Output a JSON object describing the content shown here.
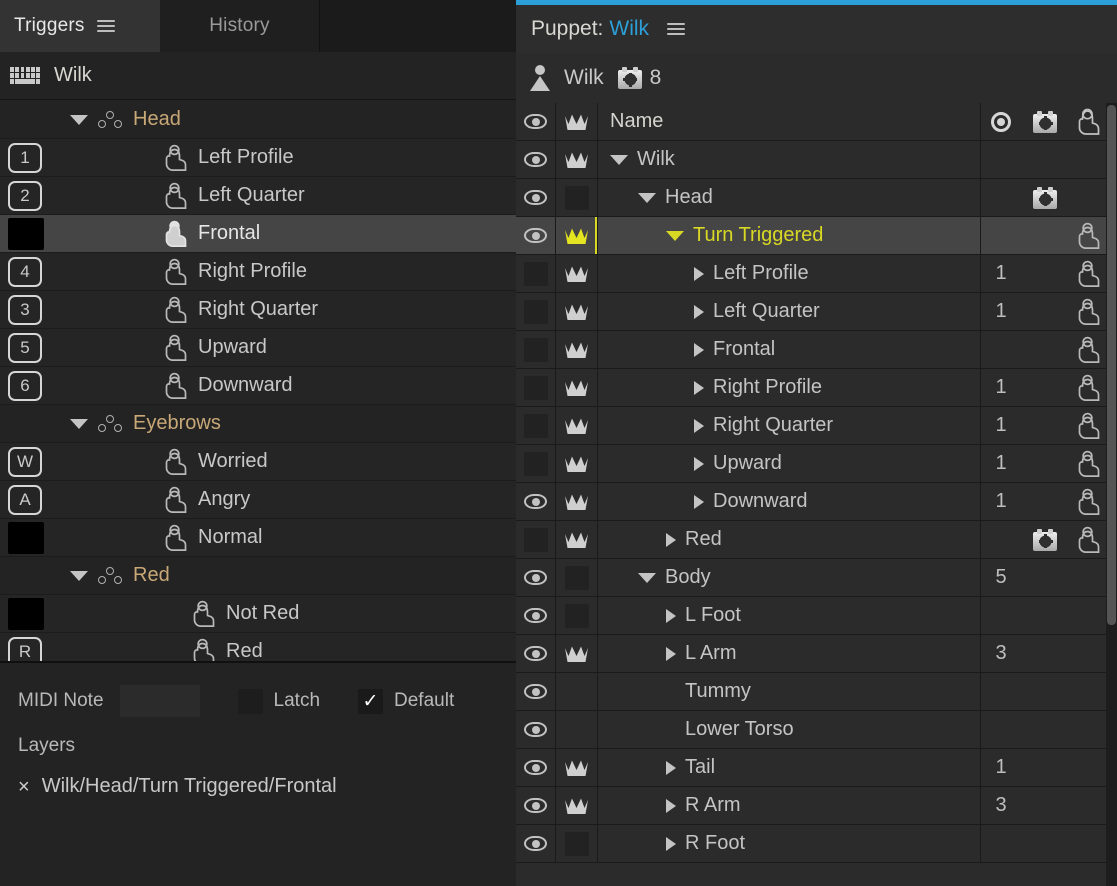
{
  "colors": {
    "accent_blue": "#2d9fd8",
    "selected_yellow": "#d8d825",
    "group_label": "#c9a877",
    "panel_bg": "#2b2b2b",
    "row_selected": "#454545"
  },
  "triggers_panel": {
    "tabs": [
      {
        "label": "Triggers",
        "active": true
      },
      {
        "label": "History",
        "active": false
      }
    ],
    "menu_icon": "hamburger-icon",
    "puppet_bar": {
      "icon": "keyboard-icon",
      "name": "Wilk"
    },
    "rows": [
      {
        "type": "group",
        "label": "Head",
        "indent": 1,
        "expanded": true,
        "icon": "group-icon"
      },
      {
        "type": "trigger",
        "label": "Left Profile",
        "indent": 2,
        "key": "1",
        "selected": false
      },
      {
        "type": "trigger",
        "label": "Left Quarter",
        "indent": 2,
        "key": "2",
        "selected": false
      },
      {
        "type": "trigger",
        "label": "Frontal",
        "indent": 2,
        "key": "",
        "selected": true
      },
      {
        "type": "trigger",
        "label": "Right Profile",
        "indent": 2,
        "key": "4",
        "selected": false
      },
      {
        "type": "trigger",
        "label": "Right Quarter",
        "indent": 2,
        "key": "3",
        "selected": false
      },
      {
        "type": "trigger",
        "label": "Upward",
        "indent": 2,
        "key": "5",
        "selected": false
      },
      {
        "type": "trigger",
        "label": "Downward",
        "indent": 2,
        "key": "6",
        "selected": false
      },
      {
        "type": "group",
        "label": "Eyebrows",
        "indent": 1,
        "expanded": true,
        "icon": "group-icon"
      },
      {
        "type": "trigger",
        "label": "Worried",
        "indent": 2,
        "key": "W",
        "selected": false
      },
      {
        "type": "trigger",
        "label": "Angry",
        "indent": 2,
        "key": "A",
        "selected": false
      },
      {
        "type": "trigger",
        "label": "Normal",
        "indent": 2,
        "key": "",
        "selected": false
      },
      {
        "type": "group",
        "label": "Red",
        "indent": 1,
        "expanded": true,
        "icon": "group-icon"
      },
      {
        "type": "trigger",
        "label": "Not Red",
        "indent": 3,
        "key": "",
        "selected": false
      },
      {
        "type": "trigger",
        "label": "Red",
        "indent": 3,
        "key": "R",
        "selected": false
      }
    ],
    "properties": {
      "midi_note_label": "MIDI Note",
      "midi_note_value": "",
      "latch_label": "Latch",
      "latch_checked": false,
      "default_label": "Default",
      "default_checked": true,
      "default_check_glyph": "✓",
      "layers_label": "Layers",
      "layer_remove_glyph": "×",
      "layer_path": "Wilk/Head/Turn Triggered/Frontal"
    }
  },
  "puppet_panel": {
    "title_prefix": "Puppet:",
    "title_name": "Wilk",
    "menu_icon": "hamburger-icon",
    "breadcrumb": {
      "person_icon": "person-icon",
      "name": "Wilk",
      "behavior_icon": "behavior-icon",
      "behavior_count": "8"
    },
    "columns": {
      "eye": "eye-icon",
      "crown": "crown-icon",
      "name": "Name",
      "record": "record-dot-icon",
      "behavior": "behavior-icon",
      "trigger": "hand-trigger-icon"
    },
    "rows": [
      {
        "label": "Wilk",
        "indent": 0,
        "disc": "open",
        "eye": "visible",
        "crown": "white",
        "rec": "",
        "beh": false,
        "hand": false,
        "selected": false
      },
      {
        "label": "Head",
        "indent": 1,
        "disc": "open",
        "eye": "visible",
        "crown": "box",
        "rec": "",
        "beh": true,
        "hand": false,
        "selected": false
      },
      {
        "label": "Turn Triggered",
        "indent": 2,
        "disc": "open",
        "eye": "visible",
        "crown": "yellow",
        "rec": "",
        "beh": false,
        "hand": true,
        "selected": true
      },
      {
        "label": "Left Profile",
        "indent": 3,
        "disc": "closed",
        "eye": "box",
        "crown": "white",
        "rec": "1",
        "beh": false,
        "hand": true,
        "selected": false
      },
      {
        "label": "Left Quarter",
        "indent": 3,
        "disc": "closed",
        "eye": "box",
        "crown": "white",
        "rec": "1",
        "beh": false,
        "hand": true,
        "selected": false
      },
      {
        "label": "Frontal",
        "indent": 3,
        "disc": "closed",
        "eye": "box",
        "crown": "white",
        "rec": "",
        "beh": false,
        "hand": true,
        "selected": false
      },
      {
        "label": "Right Profile",
        "indent": 3,
        "disc": "closed",
        "eye": "box",
        "crown": "white",
        "rec": "1",
        "beh": false,
        "hand": true,
        "selected": false
      },
      {
        "label": "Right Quarter",
        "indent": 3,
        "disc": "closed",
        "eye": "box",
        "crown": "white",
        "rec": "1",
        "beh": false,
        "hand": true,
        "selected": false
      },
      {
        "label": "Upward",
        "indent": 3,
        "disc": "closed",
        "eye": "box",
        "crown": "white",
        "rec": "1",
        "beh": false,
        "hand": true,
        "selected": false
      },
      {
        "label": "Downward",
        "indent": 3,
        "disc": "closed",
        "eye": "visible",
        "crown": "white",
        "rec": "1",
        "beh": false,
        "hand": true,
        "selected": false
      },
      {
        "label": "Red",
        "indent": 2,
        "disc": "closed",
        "eye": "box",
        "crown": "white",
        "rec": "",
        "beh": true,
        "hand": true,
        "selected": false
      },
      {
        "label": "Body",
        "indent": 1,
        "disc": "open",
        "eye": "visible",
        "crown": "box",
        "rec": "5",
        "beh": false,
        "hand": false,
        "selected": false
      },
      {
        "label": "L Foot",
        "indent": 2,
        "disc": "closed",
        "eye": "visible",
        "crown": "box",
        "rec": "",
        "beh": false,
        "hand": false,
        "selected": false
      },
      {
        "label": "L Arm",
        "indent": 2,
        "disc": "closed",
        "eye": "visible",
        "crown": "white",
        "rec": "3",
        "beh": false,
        "hand": false,
        "selected": false
      },
      {
        "label": "Tummy",
        "indent": 2,
        "disc": "none",
        "eye": "visible",
        "crown": "none",
        "rec": "",
        "beh": false,
        "hand": false,
        "selected": false
      },
      {
        "label": "Lower Torso",
        "indent": 2,
        "disc": "none",
        "eye": "visible",
        "crown": "none",
        "rec": "",
        "beh": false,
        "hand": false,
        "selected": false
      },
      {
        "label": "Tail",
        "indent": 2,
        "disc": "closed",
        "eye": "visible",
        "crown": "white",
        "rec": "1",
        "beh": false,
        "hand": false,
        "selected": false
      },
      {
        "label": "R Arm",
        "indent": 2,
        "disc": "closed",
        "eye": "visible",
        "crown": "white",
        "rec": "3",
        "beh": false,
        "hand": false,
        "selected": false
      },
      {
        "label": "R Foot",
        "indent": 2,
        "disc": "closed",
        "eye": "visible",
        "crown": "box",
        "rec": "",
        "beh": false,
        "hand": false,
        "selected": false
      }
    ]
  }
}
